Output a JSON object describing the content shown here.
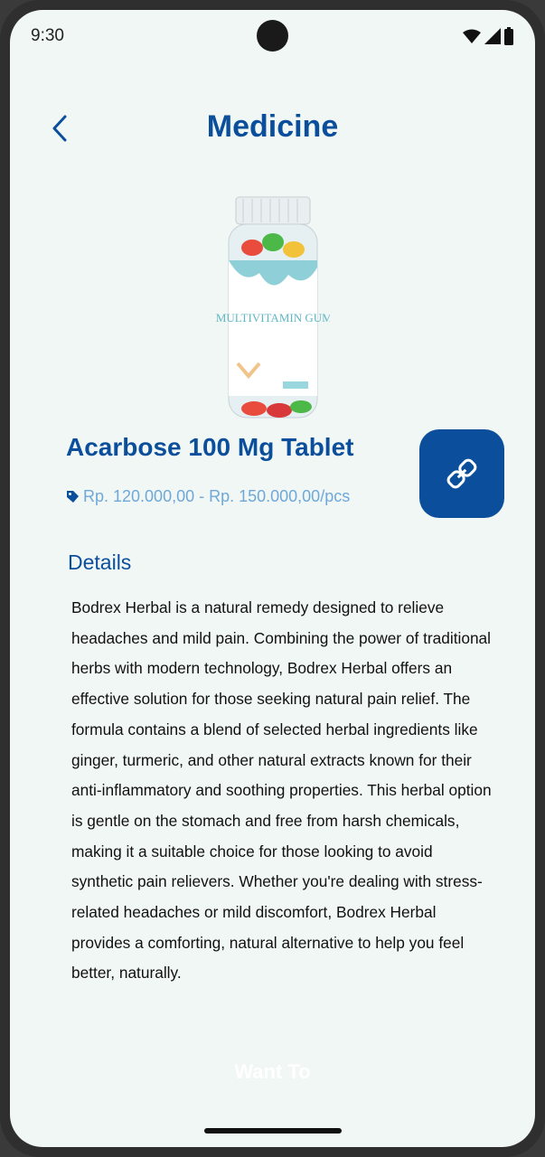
{
  "status_bar": {
    "time": "9:30"
  },
  "header": {
    "title": "Medicine"
  },
  "product": {
    "image_label": "KIDS MULTIVITAMIN GUMMIES",
    "name": "Acarbose 100 Mg Tablet",
    "price": "Rp. 120.000,00 - Rp. 150.000,00/pcs"
  },
  "details": {
    "heading": "Details",
    "description": "Bodrex Herbal is a natural remedy designed to relieve headaches and mild pain. Combining the power of traditional herbs with modern technology, Bodrex Herbal offers an effective solution for those seeking natural pain relief. The formula contains a blend of selected herbal ingredients like ginger, turmeric, and other natural extracts known for their anti-inflammatory and soothing properties. This herbal option is gentle on the stomach and free from harsh chemicals, making it a suitable choice for those looking to avoid synthetic pain relievers. Whether you're dealing with stress-related headaches or mild discomfort, Bodrex Herbal provides a comforting, natural alternative to help you feel better, naturally."
  },
  "cta": {
    "label": "Want To"
  },
  "icons": {
    "back": "chevron-left-icon",
    "link": "link-icon",
    "price_tag": "tag-icon",
    "wifi": "wifi-icon",
    "signal": "signal-icon",
    "battery": "battery-icon"
  },
  "colors": {
    "primary": "#0b4f9c",
    "price": "#6fa8d8",
    "background": "#f1f7f5"
  }
}
